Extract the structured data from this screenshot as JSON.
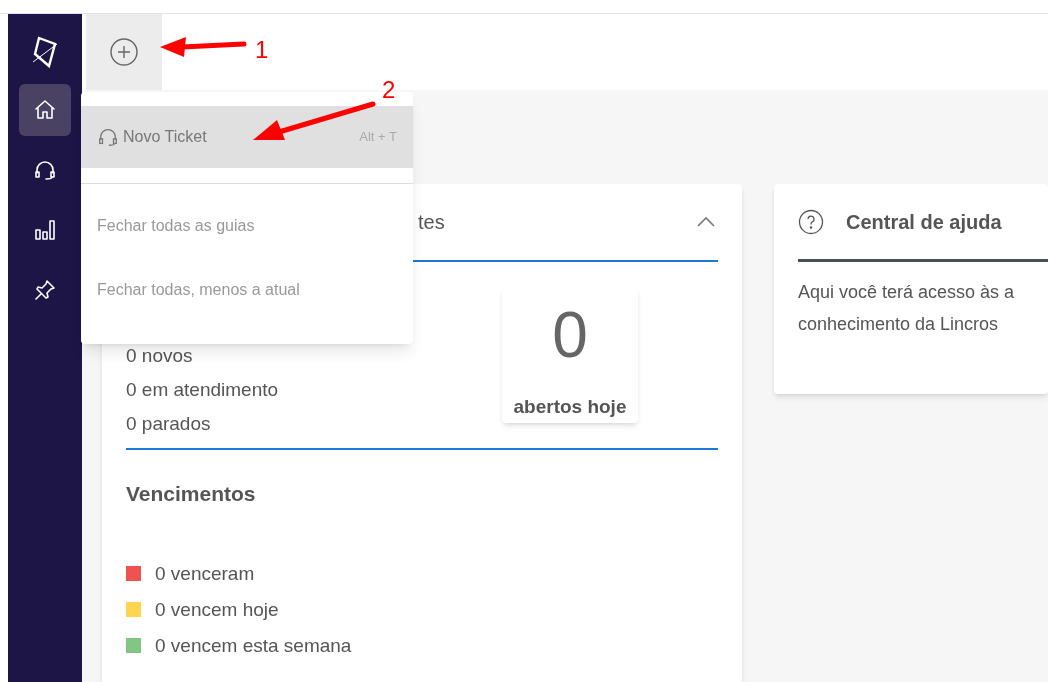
{
  "sidebar": {
    "items": [
      {
        "kind": "home",
        "selected": true
      },
      {
        "kind": "headset",
        "selected": false
      },
      {
        "kind": "chart",
        "selected": false
      },
      {
        "kind": "pin",
        "selected": false
      }
    ]
  },
  "menu": {
    "items": [
      {
        "kind": "action",
        "label": "Novo Ticket",
        "shortcut": "Alt + T",
        "selected": true
      },
      {
        "kind": "plain",
        "label": "Fechar todas as guias",
        "selected": false
      },
      {
        "kind": "plain",
        "label": "Fechar todas, menos a atual",
        "selected": false
      }
    ]
  },
  "tickets_card": {
    "title": "tes",
    "expanded": true,
    "counts": [
      "0 novos",
      "0 em atendimento",
      "0 parados"
    ],
    "today": {
      "value": "0",
      "label": "abertos hoje"
    },
    "due": {
      "title": "Vencimentos",
      "items": [
        {
          "label": "0 venceram",
          "color": "#ef5350"
        },
        {
          "label": "0 vencem hoje",
          "color": "#ffd54f"
        },
        {
          "label": "0 vencem esta semana",
          "color": "#81c784"
        }
      ]
    }
  },
  "help_card": {
    "title": "Central de ajuda",
    "lines": [
      "Aqui você terá acesso às a",
      "conhecimento da Lincros"
    ]
  },
  "annotations": [
    {
      "label": "1"
    },
    {
      "label": "2"
    }
  ]
}
